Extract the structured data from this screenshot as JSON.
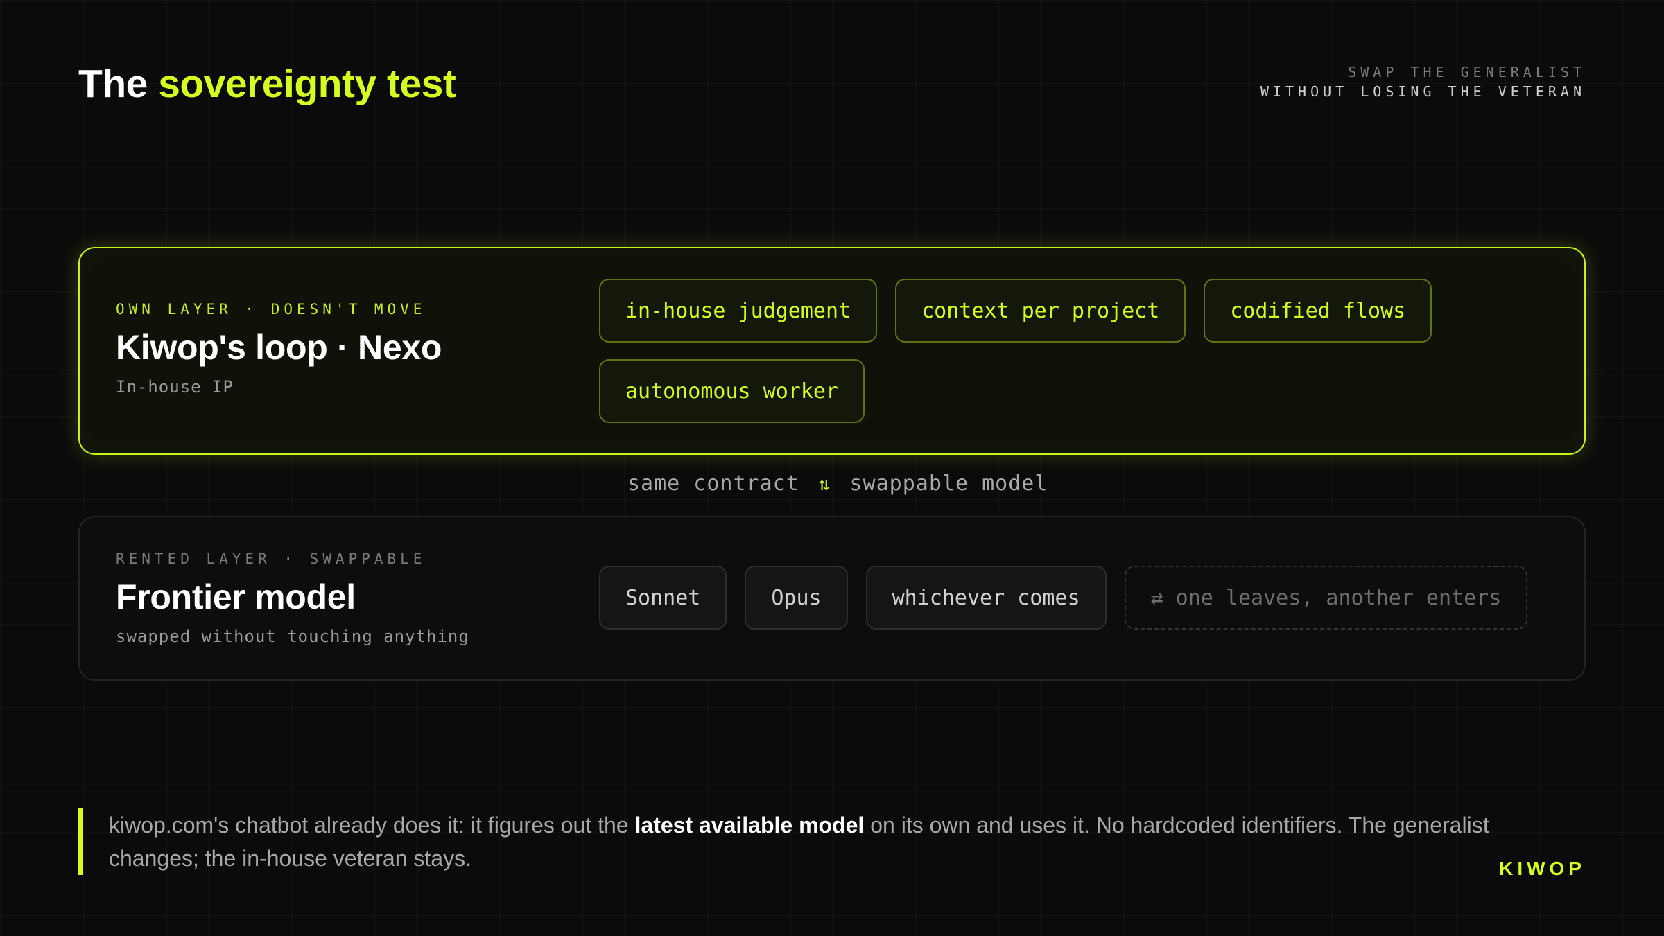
{
  "header": {
    "title_prefix": "The",
    "title_accent": "sovereignty test",
    "tagline_line1": "SWAP THE GENERALIST",
    "tagline_line2": "WITHOUT LOSING THE VETERAN"
  },
  "own_layer": {
    "eyebrow": "OWN LAYER · DOESN'T MOVE",
    "title": "Kiwop's loop · Nexo",
    "subtitle": "In-house IP",
    "chips": [
      "in-house judgement",
      "context per project",
      "codified flows",
      "autonomous worker"
    ]
  },
  "connector": {
    "left": "same contract",
    "arrows": "⇅",
    "right": "swappable model"
  },
  "rented_layer": {
    "eyebrow": "RENTED LAYER · SWAPPABLE",
    "title": "Frontier model",
    "subtitle": "swapped without touching anything",
    "chips": [
      "Sonnet",
      "Opus",
      "whichever comes"
    ],
    "dashed_chip": "⇄ one leaves, another enters"
  },
  "footer": {
    "quote_before": "kiwop.com's chatbot already does it: it figures out the ",
    "quote_bold": "latest available model",
    "quote_after": " on its own and uses it. No hardcoded identifiers. The generalist changes; the in-house veteran stays.",
    "brand": "KIWOP"
  },
  "colors": {
    "background": "#0b0b0b",
    "accent": "#d4ff1f",
    "muted_text": "#a8a8a8"
  }
}
